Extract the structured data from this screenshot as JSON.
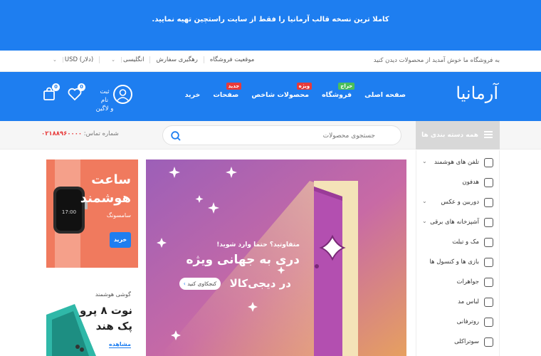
{
  "announcement": "کاملا ترین نسخه قالب آرمانیا را فقط از سایت راستچین تهیه نمایید.",
  "topbar": {
    "welcome": "به فروشگاه ما خوش آمدید از محصولات دیدن کنید",
    "links": {
      "location": "موقعیت فروشگاه",
      "tracking": "رهگیری سفارش",
      "language": "انگلیسی",
      "currency": "USD (دلار)"
    }
  },
  "header": {
    "logo": "آرمانیا",
    "nav": [
      {
        "label": "صفحه اصلی",
        "badge": "",
        "badge_color": ""
      },
      {
        "label": "فروشگاه",
        "badge": "حراج",
        "badge_color": "#4bbf5a"
      },
      {
        "label": "محصولات شاخص",
        "badge": "ویژه",
        "badge_color": "#e83a3a"
      },
      {
        "label": "صفحات",
        "badge": "جدید",
        "badge_color": "#e83a3a"
      },
      {
        "label": "خرید",
        "badge": "",
        "badge_color": ""
      }
    ],
    "account_label_1": "ثبت نام",
    "account_label_2": "و لاگین",
    "wishlist_count": "0",
    "cart_count": "0"
  },
  "catbar": {
    "all_categories": "همه دسته بندی ها",
    "search_placeholder": "جستجوی محصولات",
    "phone_label": "شماره تماس:",
    "phone_number": "۰۲۱۸۸۹۶۰۰۰۰"
  },
  "sidebar": {
    "items": [
      {
        "label": "تلفن های هوشمند",
        "icon": "phone-icon",
        "has_sub": true
      },
      {
        "label": "هدفون",
        "icon": "headphone-icon",
        "has_sub": false
      },
      {
        "label": "دوربین و عکس",
        "icon": "camera-icon",
        "has_sub": true
      },
      {
        "label": "آشپزخانه های برقی",
        "icon": "kitchen-icon",
        "has_sub": true
      },
      {
        "label": "مک و تبلت",
        "icon": "tablet-icon",
        "has_sub": false
      },
      {
        "label": "بازی ها و کنسول ها",
        "icon": "gamepad-icon",
        "has_sub": false
      },
      {
        "label": "جواهرات",
        "icon": "diamond-icon",
        "has_sub": false
      },
      {
        "label": "لباس مد",
        "icon": "shirt-icon",
        "has_sub": false
      },
      {
        "label": "روترفانی",
        "icon": "router-icon",
        "has_sub": false
      },
      {
        "label": "سوتراکلی",
        "icon": "speaker-icon",
        "has_sub": false
      }
    ]
  },
  "hero": {
    "line1": "متفاوتید؟ حتما وارد شوید!",
    "line2": "دری به جهانی ویژه",
    "line3": "در دیجی‌کالا",
    "button": "کنجکاوی کنید"
  },
  "banner_watch": {
    "title1": "ساعت",
    "title2": "هوشمند",
    "brand": "سامسونگ",
    "button": "خرید",
    "watch_time": "17:00"
  },
  "banner_phone": {
    "subtitle": "گوشی هوشمند",
    "title1": "نوت ۸ پرو",
    "title2": "پک هند",
    "link": "مشاهده"
  },
  "colors": {
    "primary": "#1e7ef0",
    "badge_green": "#4bbf5a",
    "badge_red": "#e83a3a"
  }
}
